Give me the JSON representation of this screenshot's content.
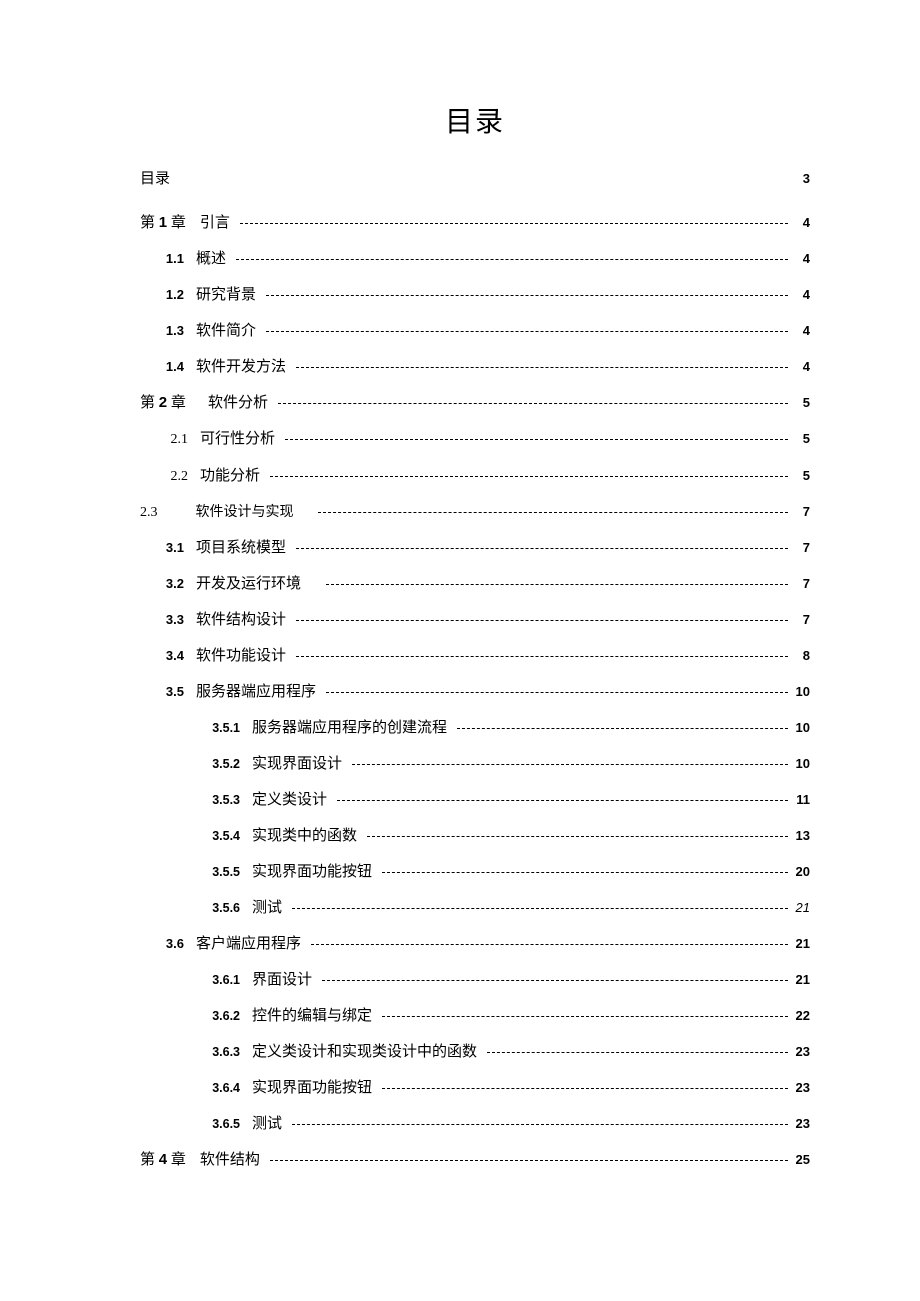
{
  "title": "目录",
  "entries": [
    {
      "id": "toc-self",
      "cls": "lvl0 top-entry no-leader",
      "num": "",
      "label": "目录",
      "page": "3",
      "pgcls": ""
    },
    {
      "id": "ch1",
      "cls": "chapter",
      "num": "第 1 章",
      "numInner": "第 <span class='d'>1</span> 章",
      "label": "引言",
      "page": "4",
      "pgcls": ""
    },
    {
      "id": "s1-1",
      "cls": "lvl1",
      "num": "1.1",
      "label": "概述 ",
      "page": "4",
      "pgcls": ""
    },
    {
      "id": "s1-2",
      "cls": "lvl1",
      "num": "1.2",
      "label": "研究背景 ",
      "page": "4",
      "pgcls": ""
    },
    {
      "id": "s1-3",
      "cls": "lvl1",
      "num": "1.3",
      "label": "软件简介 ",
      "page": "4",
      "pgcls": ""
    },
    {
      "id": "s1-4",
      "cls": "lvl1",
      "num": "1.4",
      "label": "软件开发方法 ",
      "page": "4",
      "pgcls": ""
    },
    {
      "id": "ch2",
      "cls": "chapter chapter2",
      "num": "第 2 章",
      "numInner": "第 <span class='d'>2</span> 章",
      "label": "软件分析 ",
      "page": "5",
      "pgcls": ""
    },
    {
      "id": "s2-1",
      "cls": "lvl1 lvl1alt",
      "num": "2.1",
      "label": "可行性分析 ",
      "page": "5",
      "pgcls": ""
    },
    {
      "id": "s2-2",
      "cls": "lvl1 lvl1alt",
      "num": "2.2",
      "label": "功能分析",
      "page": "5",
      "pgcls": ""
    },
    {
      "id": "s2-3",
      "cls": "sec23",
      "num": "2.3",
      "label": "软件设计与实现　",
      "page": "7",
      "pgcls": ""
    },
    {
      "id": "s3-1",
      "cls": "lvl1",
      "num": "3.1",
      "label": "项目系统模型 ",
      "page": "7",
      "pgcls": ""
    },
    {
      "id": "s3-2",
      "cls": "lvl1",
      "num": "3.2",
      "label": "开发及运行环境　",
      "page": "7",
      "pgcls": ""
    },
    {
      "id": "s3-3",
      "cls": "lvl1",
      "num": "3.3",
      "label": "软件结构设计 ",
      "page": "7",
      "pgcls": ""
    },
    {
      "id": "s3-4",
      "cls": "lvl1",
      "num": "3.4",
      "label": "软件功能设计",
      "page": "8",
      "pgcls": ""
    },
    {
      "id": "s3-5",
      "cls": "lvl1",
      "num": "3.5",
      "label": "服务器端应用程序 ",
      "page": "10",
      "pgcls": ""
    },
    {
      "id": "s3-5-1",
      "cls": "lvl2",
      "num": "3.5.1",
      "label": "服务器端应用程序的创建流程 ",
      "page": "10",
      "pgcls": ""
    },
    {
      "id": "s3-5-2",
      "cls": "lvl2",
      "num": "3.5.2",
      "label": "实现界面设计 ",
      "page": "10",
      "pgcls": ""
    },
    {
      "id": "s3-5-3",
      "cls": "lvl2",
      "num": "3.5.3",
      "label": "定义类设计 ",
      "page": "11",
      "pgcls": ""
    },
    {
      "id": "s3-5-4",
      "cls": "lvl2",
      "num": "3.5.4",
      "label": "实现类中的函数",
      "page": "13",
      "pgcls": ""
    },
    {
      "id": "s3-5-5",
      "cls": "lvl2",
      "num": "3.5.5",
      "label": "实现界面功能按钮",
      "page": "20",
      "pgcls": ""
    },
    {
      "id": "s3-5-6",
      "cls": "lvl2",
      "num": "3.5.6",
      "label": "测试 ",
      "page": "21",
      "pgcls": "italic"
    },
    {
      "id": "s3-6",
      "cls": "lvl1",
      "num": "3.6",
      "label": "客户端应用程序 ",
      "page": "21",
      "pgcls": ""
    },
    {
      "id": "s3-6-1",
      "cls": "lvl2",
      "num": "3.6.1",
      "label": "界面设计 ",
      "page": "21",
      "pgcls": ""
    },
    {
      "id": "s3-6-2",
      "cls": "lvl2",
      "num": "3.6.2",
      "label": "控件的编辑与绑定",
      "page": "22",
      "pgcls": ""
    },
    {
      "id": "s3-6-3",
      "cls": "lvl2",
      "num": "3.6.3",
      "label": "定义类设计和实现类设计中的函数",
      "page": "23",
      "pgcls": ""
    },
    {
      "id": "s3-6-4",
      "cls": "lvl2",
      "num": "3.6.4",
      "label": "实现界面功能按钮",
      "page": "23",
      "pgcls": ""
    },
    {
      "id": "s3-6-5",
      "cls": "lvl2",
      "num": "3.6.5",
      "label": "测试",
      "page": "23",
      "pgcls": ""
    },
    {
      "id": "ch4",
      "cls": "chapter ch4",
      "num": "第 4 章",
      "numInner": "第 <span class='d'>4</span> 章",
      "label": "软件结构",
      "page": "25",
      "pgcls": ""
    }
  ]
}
